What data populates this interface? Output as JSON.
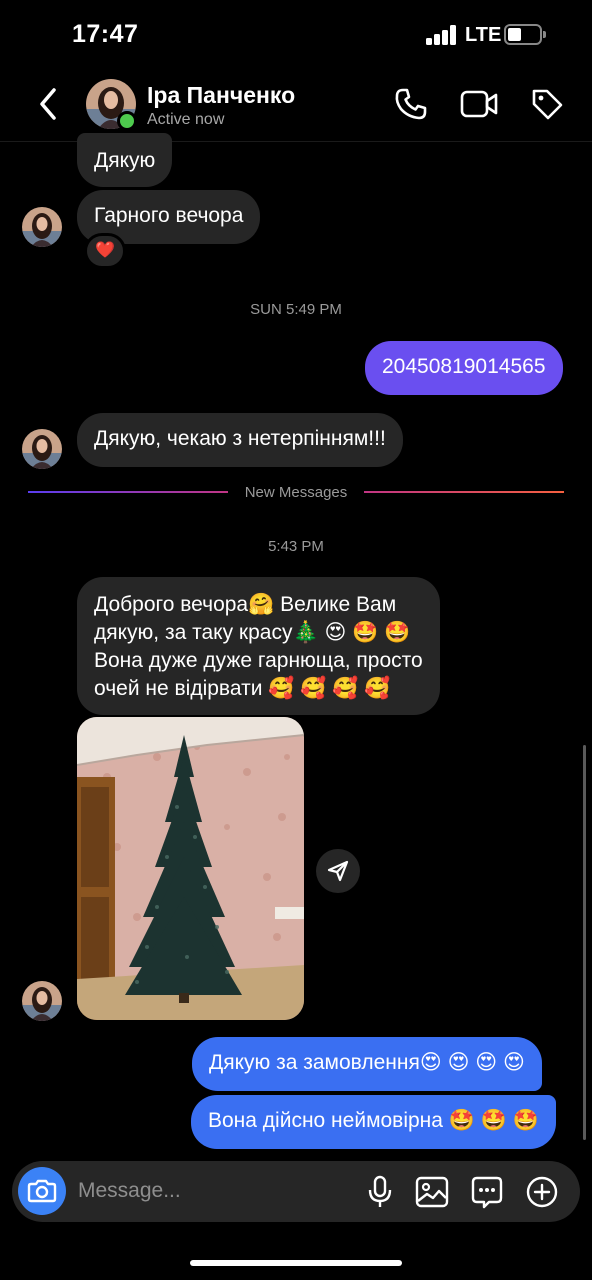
{
  "status_bar": {
    "time": "17:47",
    "network": "LTE"
  },
  "header": {
    "name": "Іра Панченко",
    "status": "Active now"
  },
  "messages": {
    "m1": "Дякую",
    "m2": "Гарного вечора",
    "m2_reaction": "❤️",
    "ts1": "SUN 5:49 PM",
    "m3": "20450819014565",
    "m4": "Дякую, чекаю з нетерпінням!!!",
    "divider": "New Messages",
    "ts2": "5:43 PM",
    "m5_line1": "Доброго вечора🤗  Велике Вам",
    "m5_line2": "дякую,  за таку красу🎄 😍 🤩 🤩",
    "m5_line3": "Вона дуже дуже гарнюща, просто",
    "m5_line4": "очей  не відірвати 🥰 🥰 🥰 🥰",
    "m6": "Дякую за замовлення😍 😍 😍 😍",
    "m7": "Вона дійсно неймовірна 🤩 🤩 🤩"
  },
  "composer": {
    "placeholder": "Message..."
  },
  "colors": {
    "incoming": "#262626",
    "outgoing_purple": "#6a4ff0",
    "outgoing_blue": "#3a6ff2",
    "online": "#4ecb4e"
  },
  "icons": [
    "back-icon",
    "call-icon",
    "video-icon",
    "tag-icon",
    "share-icon",
    "camera-icon",
    "mic-icon",
    "gallery-icon",
    "sticker-icon",
    "plus-icon"
  ]
}
